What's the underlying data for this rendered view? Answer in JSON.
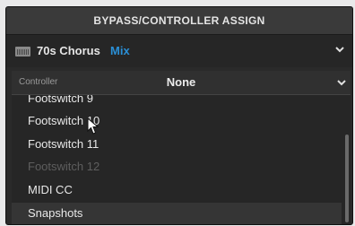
{
  "header": {
    "title": "BYPASS/CONTROLLER ASSIGN"
  },
  "block": {
    "name": "70s Chorus",
    "parameter": "Mix"
  },
  "controller": {
    "label": "Controller",
    "value": "None"
  },
  "list": {
    "items": [
      {
        "label": "Footswitch 9",
        "state": "partial"
      },
      {
        "label": "Footswitch 10",
        "state": "enabled"
      },
      {
        "label": "Footswitch 11",
        "state": "enabled"
      },
      {
        "label": "Footswitch 12",
        "state": "disabled"
      },
      {
        "label": "MIDI CC",
        "state": "enabled"
      },
      {
        "label": "Snapshots",
        "state": "hovered"
      }
    ]
  },
  "icons": {
    "block": "amp-icon",
    "block_dropdown": "chevron-down-icon",
    "controller_dropdown": "chevron-down-icon",
    "cursor": "mouse-pointer-icon"
  },
  "colors": {
    "accent": "#2a8fd6",
    "panel": "#2a2a2a",
    "disabled_text": "#5e5e5e"
  }
}
